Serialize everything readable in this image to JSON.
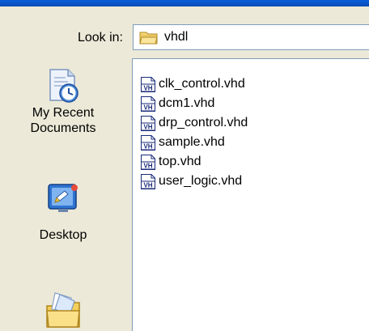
{
  "look_in": {
    "label": "Look in:",
    "value": "vhdl"
  },
  "places": [
    {
      "label": "My Recent Documents",
      "icon": "recent-documents-icon"
    },
    {
      "label": "Desktop",
      "icon": "desktop-icon"
    },
    {
      "label": "",
      "icon": "my-documents-icon"
    }
  ],
  "files": [
    {
      "name": "clk_control.vhd",
      "icon": "vhd-file-icon"
    },
    {
      "name": "dcm1.vhd",
      "icon": "vhd-file-icon"
    },
    {
      "name": "drp_control.vhd",
      "icon": "vhd-file-icon"
    },
    {
      "name": "sample.vhd",
      "icon": "vhd-file-icon"
    },
    {
      "name": "top.vhd",
      "icon": "vhd-file-icon"
    },
    {
      "name": "user_logic.vhd",
      "icon": "vhd-file-icon"
    }
  ],
  "file_icon_text": "VH"
}
